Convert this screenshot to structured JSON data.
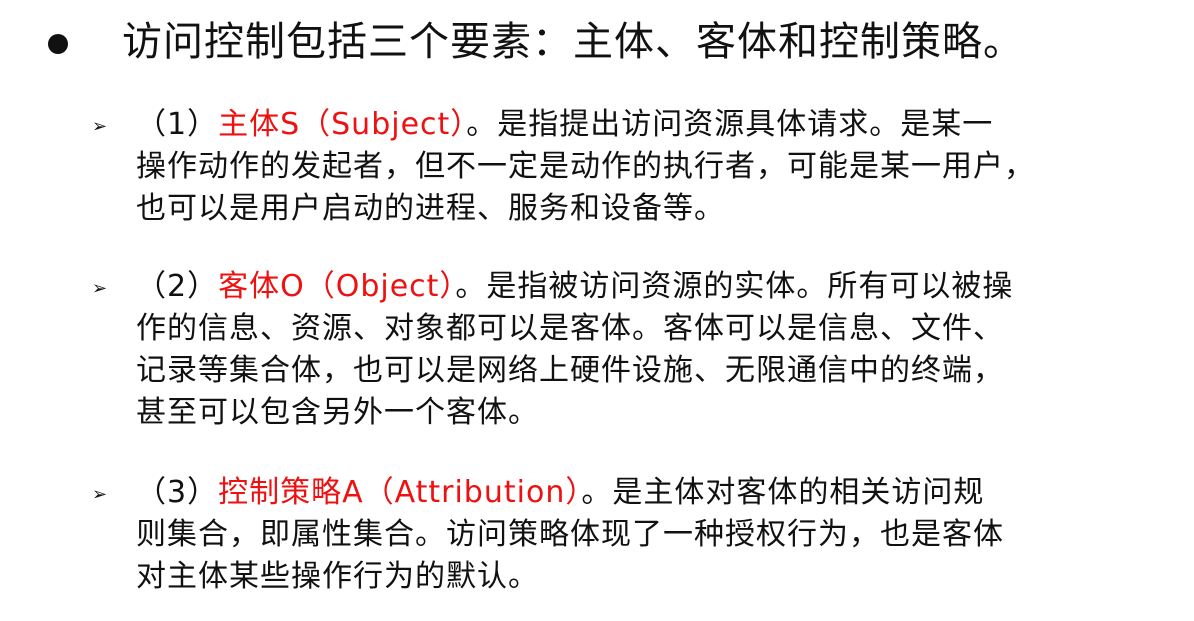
{
  "slide": {
    "main_bullet": "访问控制包括三个要素：主体、客体和控制策略。",
    "items": [
      {
        "number": "（1）",
        "term": "主体S（Subject）",
        "line1_rest": "。是指提出访问资源具体请求。是某一",
        "line2": "操作动作的发起者，但不一定是动作的执行者，可能是某一用户，",
        "line3": "也可以是用户启动的进程、服务和设备等。"
      },
      {
        "number": "（2）",
        "term": "客体O（Object）",
        "line1_rest": "。是指被访问资源的实体。所有可以被操",
        "line2": "作的信息、资源、对象都可以是客体。客体可以是信息、文件、",
        "line3": "记录等集合体，也可以是网络上硬件设施、无限通信中的终端，",
        "line4": "甚至可以包含另外一个客体。"
      },
      {
        "number": "（3）",
        "term": "控制策略A（Attribution）",
        "line1_rest": "。是主体对客体的相关访问规",
        "line2": "则集合，即属性集合。访问策略体现了一种授权行为，也是客体",
        "line3": "对主体某些操作行为的默认。"
      }
    ],
    "colors": {
      "text": "#111111",
      "highlight": "#ee1111",
      "background": "#ffffff"
    },
    "icons": {
      "main_bullet": "filled-circle-icon",
      "sub_bullet": "arrowhead-icon"
    }
  }
}
